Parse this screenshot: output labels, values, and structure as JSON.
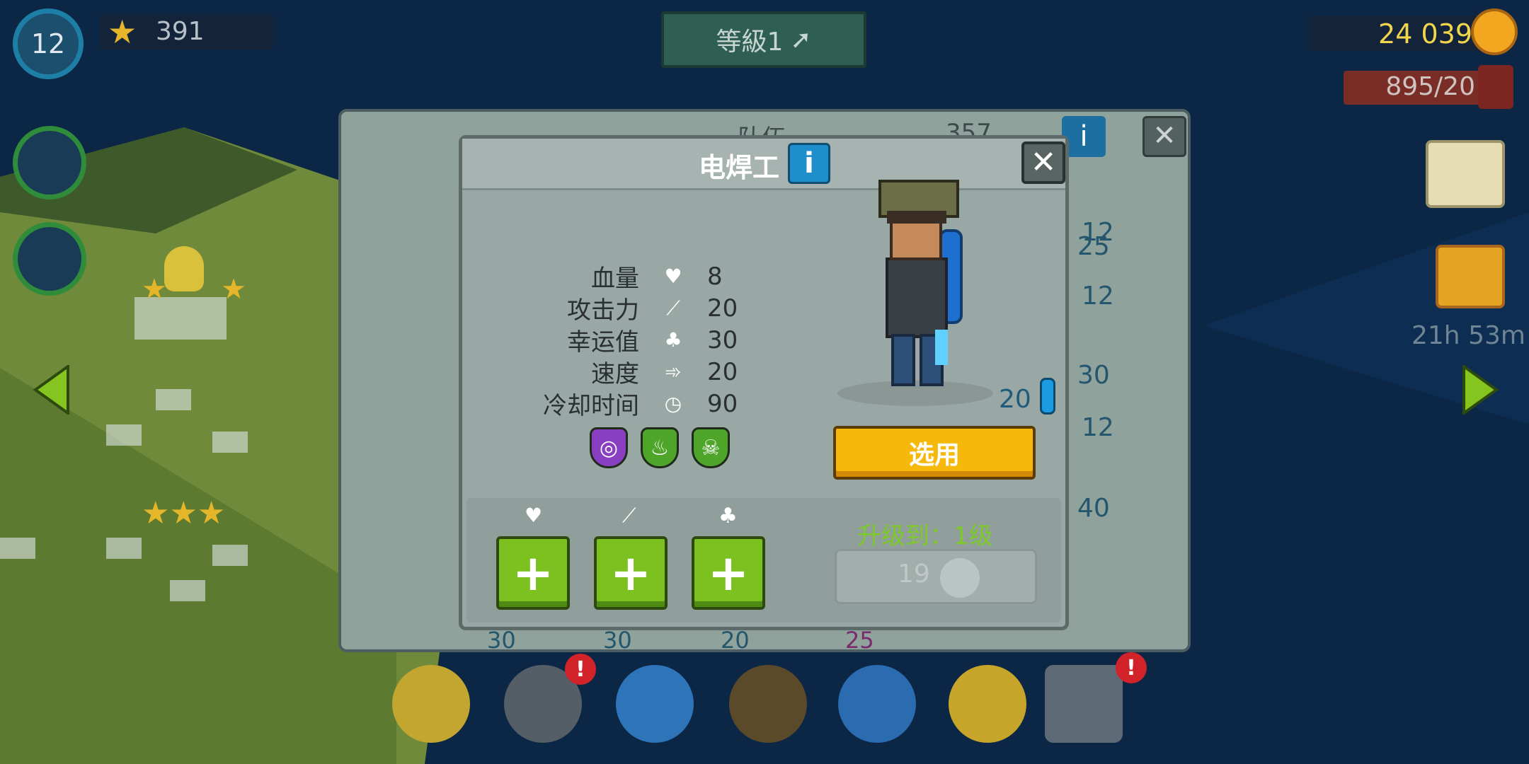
{
  "hud": {
    "player_level": "12",
    "stars": "391",
    "level_button": "等級1",
    "coins": "24 039",
    "fuel": "895/20",
    "timer": "21h 53m"
  },
  "back_panel": {
    "title": "队伍",
    "count": "357",
    "levels": [
      "12",
      "25",
      "12",
      "30",
      "12",
      "40"
    ],
    "bottom_values": [
      "30",
      "30",
      "20",
      "25"
    ]
  },
  "dialog": {
    "title": "电焊工",
    "stats": [
      {
        "label": "血量",
        "icon": "heart-icon",
        "value": "8"
      },
      {
        "label": "攻击力",
        "icon": "sword-icon",
        "value": "20"
      },
      {
        "label": "幸运值",
        "icon": "clover-icon",
        "value": "30"
      },
      {
        "label": "速度",
        "icon": "boot-icon",
        "value": "20"
      },
      {
        "label": "冷却时间",
        "icon": "stopwatch-icon",
        "value": "90"
      }
    ],
    "ammo": "20",
    "select_button": "选用",
    "upgrade_label": "升级到：1级",
    "upgrade_cost": "19",
    "colors": {
      "select_yellow": "#f6b80b",
      "plus_green": "#7cc11f",
      "upgrade_text": "#7ec92a"
    }
  }
}
